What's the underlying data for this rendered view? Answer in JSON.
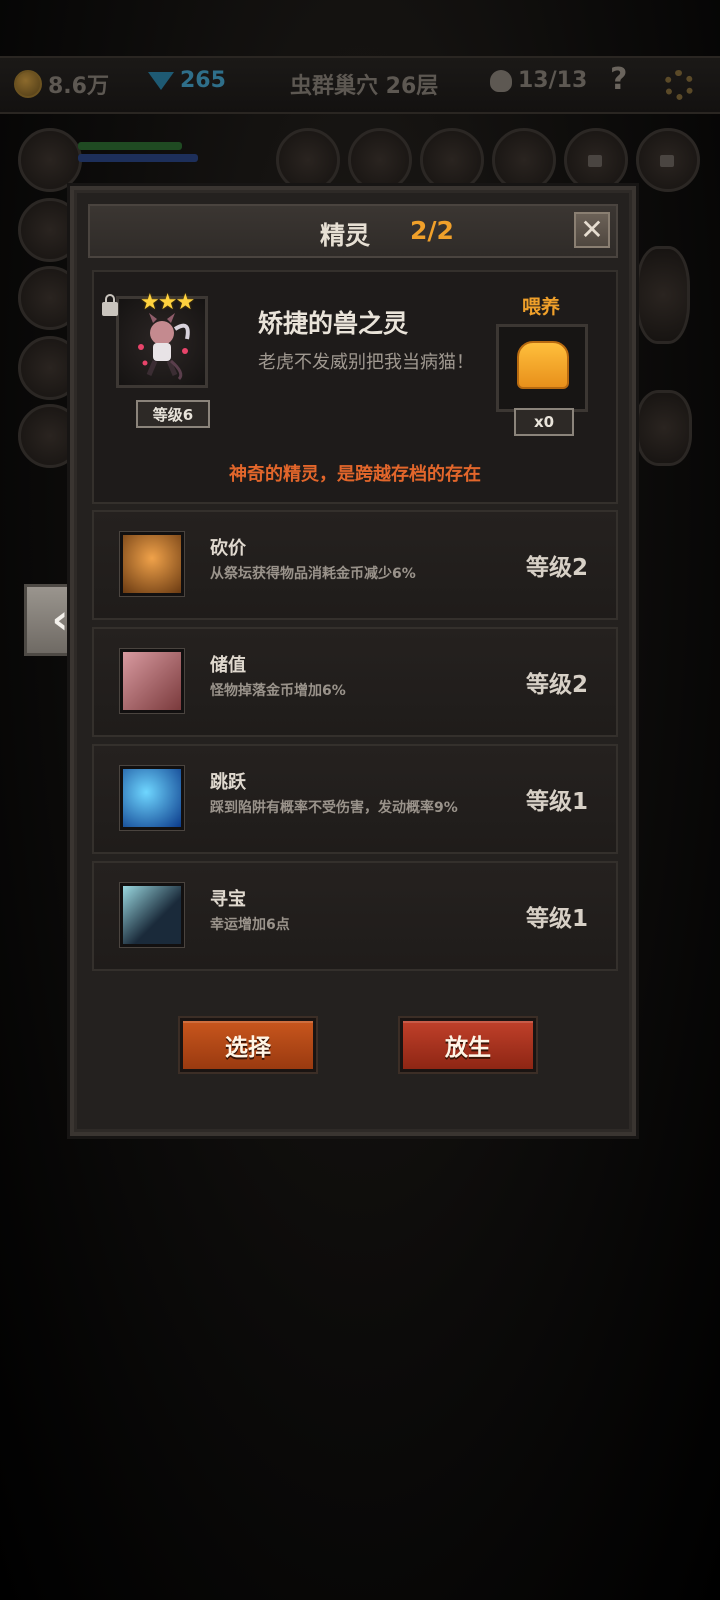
{
  "status_bar": {
    "gold": "8.6万",
    "gems": "265",
    "location": "虫群巢穴 26层",
    "kills": "13/13",
    "help_label": "?"
  },
  "dialog": {
    "title": "精灵",
    "count": "2/2",
    "close_label": "✕"
  },
  "spirit": {
    "name": "矫捷的兽之灵",
    "description": "老虎不发威别把我当病猫！",
    "level": "等级6",
    "stars": "★★★",
    "feed_label": "喂养",
    "feed_count": "x0",
    "tagline": "神奇的精灵，是跨越存档的存在"
  },
  "skills": [
    {
      "name": "砍价",
      "description": "从祭坛获得物品消耗金币减少6%",
      "level": "等级2",
      "icon": "altar-coin-icon"
    },
    {
      "name": "储值",
      "description": "怪物掉落金币增加6%",
      "level": "等级2",
      "icon": "goblet-icon"
    },
    {
      "name": "跳跃",
      "description": "踩到陷阱有概率不受伤害，发动概率9%",
      "level": "等级1",
      "icon": "leap-icon"
    },
    {
      "name": "寻宝",
      "description": "幸运增加6点",
      "level": "等级1",
      "icon": "silhouette-sparkle-icon"
    }
  ],
  "buttons": {
    "select": "选择",
    "release": "放生"
  },
  "nav": {
    "back_arrow": "‹"
  },
  "colors": {
    "accent_orange": "#f0a02a",
    "tagline_red": "#e2662b",
    "select_button": "#c8561d",
    "release_button": "#c0402a"
  }
}
